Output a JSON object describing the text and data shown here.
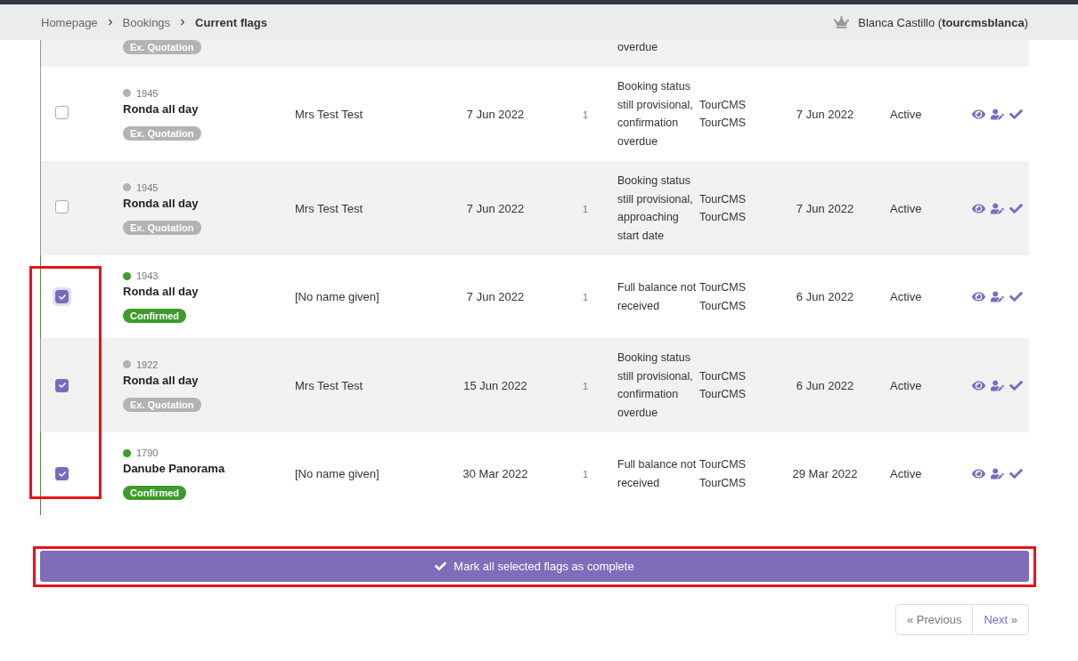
{
  "breadcrumb": [
    {
      "label": "Homepage",
      "current": false
    },
    {
      "label": "Bookings",
      "current": false
    },
    {
      "label": "Current flags",
      "current": true
    }
  ],
  "user": {
    "name": "Blanca Castillo (**tourcmsblanca**)"
  },
  "partial_row": {
    "status": "Ex. Quotation",
    "color": "#b3b3b3",
    "flag": "overdue"
  },
  "rows": [
    {
      "checked": false,
      "focused": false,
      "booking_id": "1945",
      "tour": "Ronda all day",
      "status": "Ex. Quotation",
      "color": "#b3b3b3",
      "customer": "Mrs Test Test",
      "date": "7 Jun 2022",
      "count": "1",
      "flag": "Booking status still provisional, confirmation overdue",
      "raised_by": [
        "TourCMS",
        "TourCMS"
      ],
      "due": "7 Jun 2022",
      "state": "Active"
    },
    {
      "checked": false,
      "focused": false,
      "booking_id": "1945",
      "tour": "Ronda all day",
      "status": "Ex. Quotation",
      "color": "#b3b3b3",
      "customer": "Mrs Test Test",
      "date": "7 Jun 2022",
      "count": "1",
      "flag": "Booking status still provisional, approaching start date",
      "raised_by": [
        "TourCMS",
        "TourCMS"
      ],
      "due": "7 Jun 2022",
      "state": "Active"
    },
    {
      "checked": true,
      "focused": true,
      "booking_id": "1943",
      "tour": "Ronda all day",
      "status": "Confirmed",
      "color": "#3d9b2c",
      "customer": "[No name given]",
      "date": "7 Jun 2022",
      "count": "1",
      "flag": "Full balance not received",
      "raised_by": [
        "TourCMS",
        "TourCMS"
      ],
      "due": "6 Jun 2022",
      "state": "Active"
    },
    {
      "checked": true,
      "focused": false,
      "booking_id": "1922",
      "tour": "Ronda all day",
      "status": "Ex. Quotation",
      "color": "#b3b3b3",
      "customer": "Mrs Test Test",
      "date": "15 Jun 2022",
      "count": "1",
      "flag": "Booking status still provisional, confirmation overdue",
      "raised_by": [
        "TourCMS",
        "TourCMS"
      ],
      "due": "6 Jun 2022",
      "state": "Active"
    },
    {
      "checked": true,
      "focused": false,
      "booking_id": "1790",
      "tour": "Danube Panorama",
      "status": "Confirmed",
      "color": "#3d9b2c",
      "customer": "[No name given]",
      "date": "30 Mar 2022",
      "count": "1",
      "flag": "Full balance not received",
      "raised_by": [
        "TourCMS",
        "TourCMS"
      ],
      "due": "29 Mar 2022",
      "state": "Active"
    }
  ],
  "mark_button": {
    "label": "Mark all selected flags as complete"
  },
  "pagination": [
    {
      "label": "« Previous",
      "disabled": true
    },
    {
      "label": "Next »",
      "disabled": false
    }
  ],
  "highlights": {
    "checkbox_column": true,
    "mark_button": true
  }
}
